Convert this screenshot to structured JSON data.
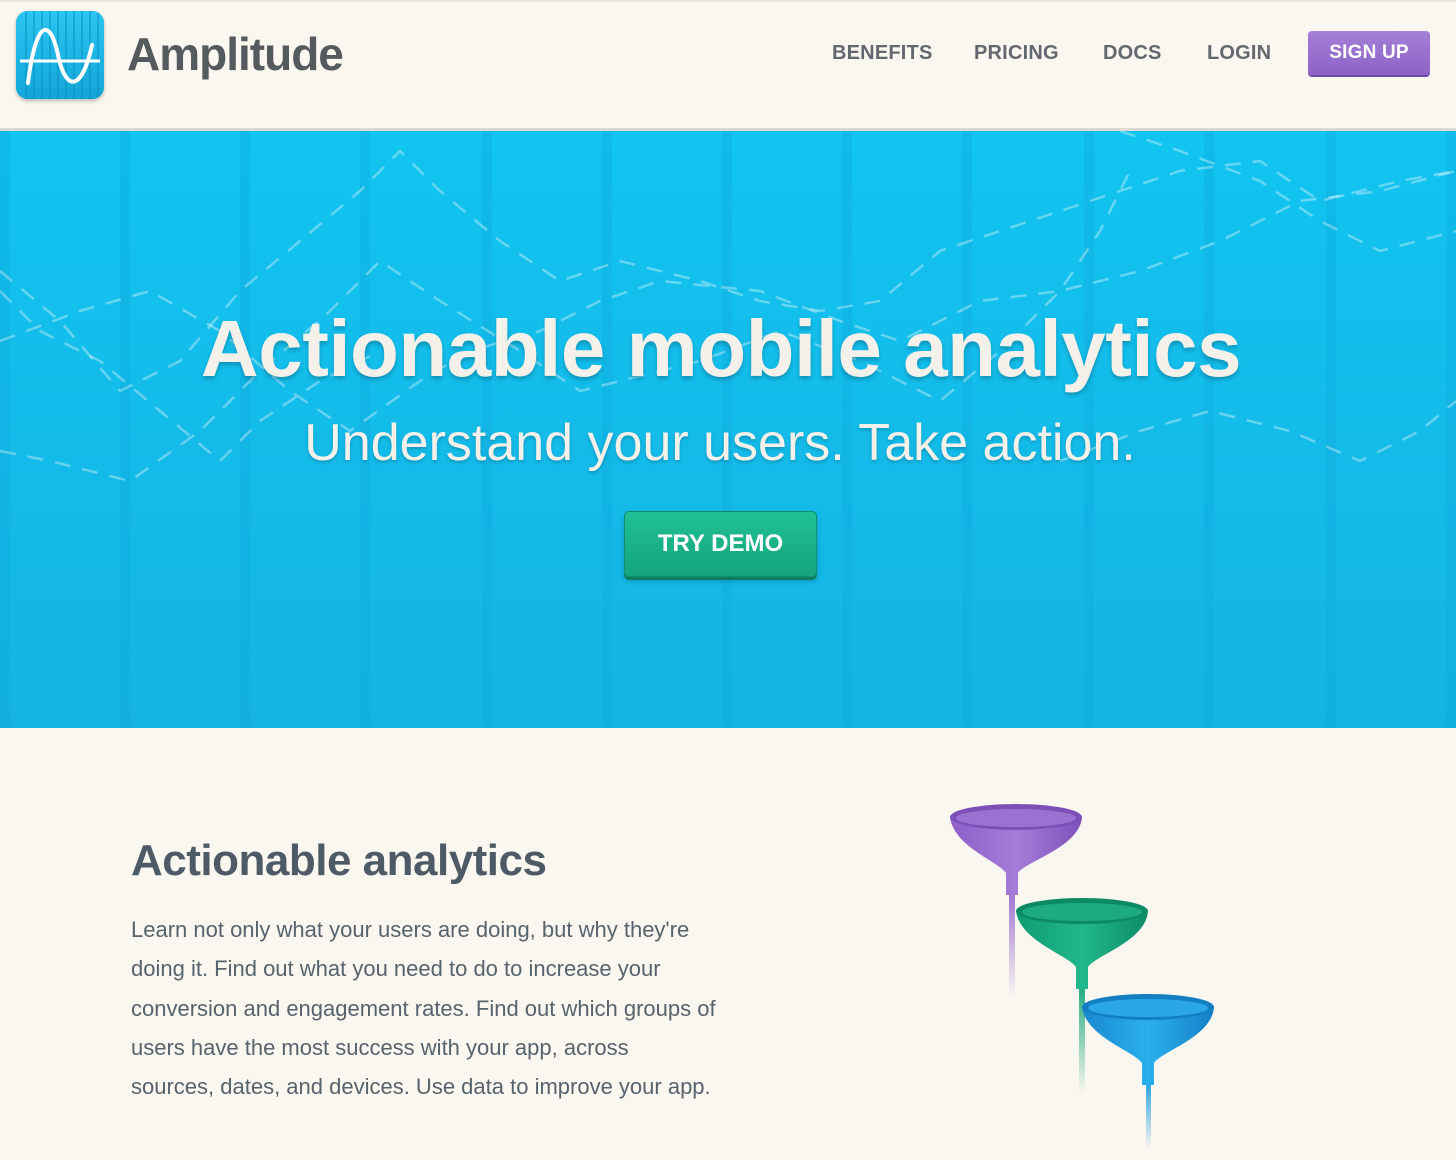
{
  "header": {
    "brand": "Amplitude",
    "logo_icon": "amplitude-wave-icon",
    "nav": [
      {
        "label": "BENEFITS"
      },
      {
        "label": "PRICING"
      },
      {
        "label": "DOCS"
      },
      {
        "label": "LOGIN"
      }
    ],
    "signup_label": "SIGN UP"
  },
  "hero": {
    "title": "Actionable mobile analytics",
    "subtitle": "Understand your users. Take action.",
    "cta_label": "TRY DEMO"
  },
  "section": {
    "title": "Actionable analytics",
    "body": "Learn not only what your users are doing, but why they're doing it. Find out what you need to do to increase your conversion and engagement rates. Find out which groups of users have the most success with your app, across sources, dates, and devices. Use data to improve your app.",
    "illustration": "funnels-illustration"
  },
  "colors": {
    "hero_blue": "#14bdec",
    "signup_purple": "#9a70d0",
    "demo_green": "#1bb38a",
    "funnel_purple": "#9b6fd1",
    "funnel_green": "#19a77c",
    "funnel_blue": "#1c9fe0"
  }
}
